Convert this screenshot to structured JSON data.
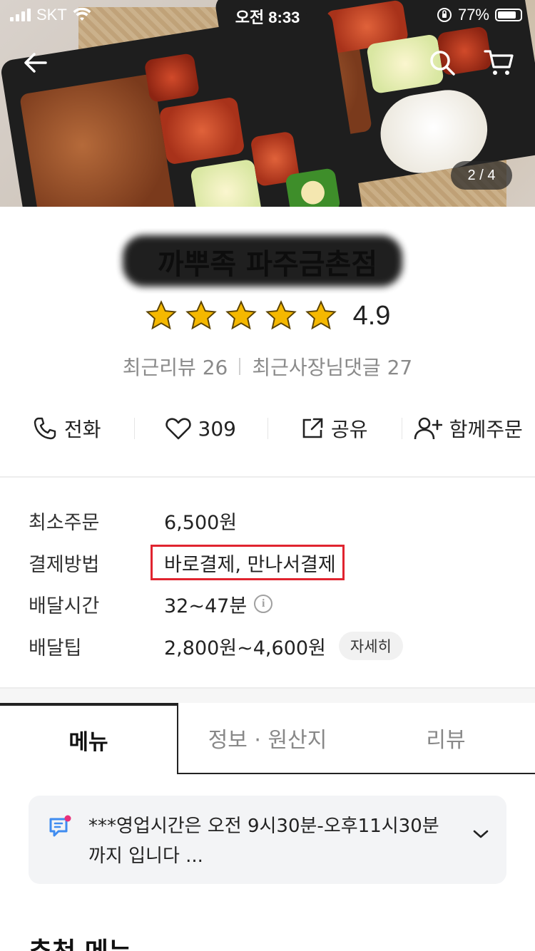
{
  "status_bar": {
    "carrier": "SKT",
    "time": "오전 8:33",
    "battery": "77%"
  },
  "hero": {
    "page_indicator": "2 / 4",
    "icons": [
      "back-arrow-icon",
      "search-icon",
      "cart-icon"
    ]
  },
  "store": {
    "name": "까뿌족 파주금촌점",
    "rating": "4.9",
    "stars": 5,
    "recent_reviews": "최근리뷰 26",
    "owner_comments": "최근사장님댓글 27"
  },
  "actions": {
    "call": "전화",
    "likes": "309",
    "share": "공유",
    "group_order": "함께주문"
  },
  "info": {
    "min_order_label": "최소주문",
    "min_order_value": "6,500원",
    "payment_label": "결제방법",
    "payment_value": "바로결제, 만나서결제",
    "delivery_time_label": "배달시간",
    "delivery_time_value": "32~47분",
    "delivery_tip_label": "배달팁",
    "delivery_tip_value": "2,800원~4,600원",
    "detail_button": "자세히"
  },
  "tabs": [
    {
      "label": "메뉴",
      "active": true
    },
    {
      "label": "정보 · 원산지",
      "active": false
    },
    {
      "label": "리뷰",
      "active": false
    }
  ],
  "notice": {
    "text": "***영업시간은 오전 9시30분-오후11시30분까지 입니다 ..."
  },
  "section": {
    "title": "추천 메뉴"
  },
  "colors": {
    "highlight": "#e0242f",
    "star": "#f5b800",
    "notice_dot": "#e8307a",
    "notice_icon": "#3f8cf0"
  }
}
